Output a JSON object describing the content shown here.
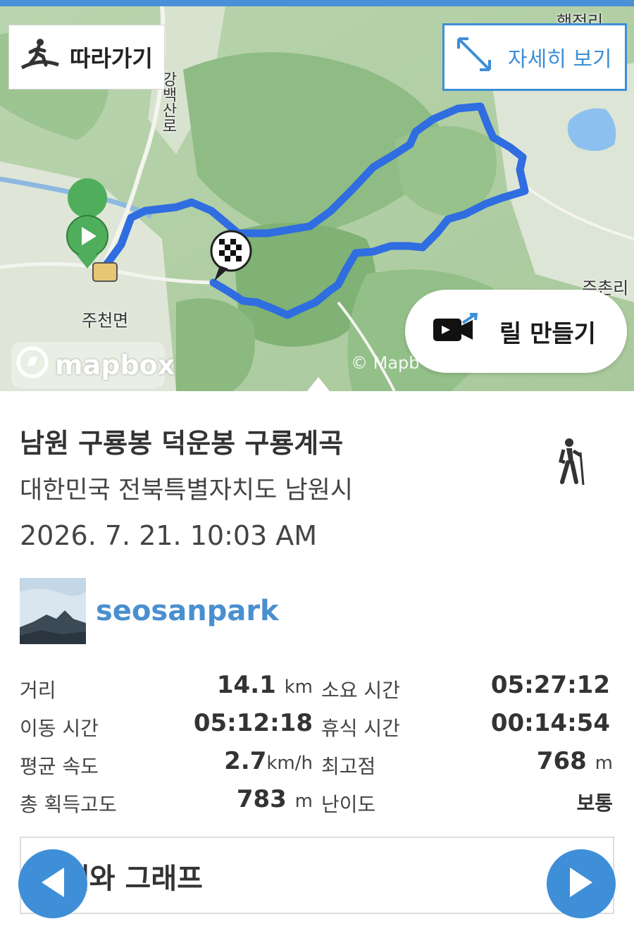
{
  "map": {
    "follow_label": "따라가기",
    "detail_label": "자세히 보기",
    "reel_label": "릴 만들기",
    "attribution_logo": "mapbox",
    "attribution_copy": "© Mapb",
    "place_labels": {
      "road": "강백산로",
      "town": "주천면",
      "village_top": "행정리",
      "village_right": "주촌리"
    },
    "route_color": "#2f6de0",
    "start_marker_color": "#4fae5c"
  },
  "track": {
    "title": "남원 구룡봉 덕운봉 구룡계곡",
    "region": "대한민국 전북특별자치도 남원시",
    "datetime": "2026. 7. 21. 10:03 AM",
    "activity_icon": "hiking-icon"
  },
  "user": {
    "name": "seosanpark",
    "avatar": "mountain-avatar"
  },
  "stats": {
    "distance": {
      "label": "거리",
      "value": "14.1",
      "unit": "km"
    },
    "total_time": {
      "label": "소요 시간",
      "value": "05:27:12"
    },
    "moving_time": {
      "label": "이동 시간",
      "value": "05:12:18"
    },
    "rest_time": {
      "label": "휴식 시간",
      "value": "00:14:54"
    },
    "avg_speed": {
      "label": "평균 속도",
      "value": "2.7",
      "unit": "km/h"
    },
    "max_elevation": {
      "label": "최고점",
      "value": "768",
      "unit": "m"
    },
    "total_ascent": {
      "label": "총 획득고도",
      "value": "783",
      "unit": "m"
    },
    "difficulty": {
      "label": "난이도",
      "value": "보통"
    }
  },
  "weather": {
    "label": "세와 그래프"
  },
  "colors": {
    "accent": "#3e8fd8",
    "username": "#4a8fd0"
  }
}
